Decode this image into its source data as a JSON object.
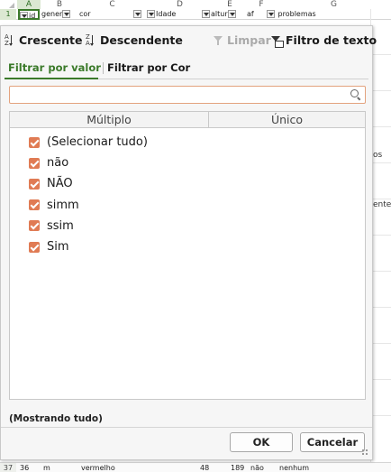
{
  "sheet": {
    "columns": [
      "A",
      "B",
      "C",
      "D",
      "E",
      "F",
      "G"
    ],
    "row1": {
      "rownum": "1",
      "A": "id",
      "B": "gener",
      "C": "cor",
      "D": "Idade",
      "E": "altur",
      "F": "af",
      "G": "problemas"
    },
    "side_texts": [
      "os",
      "ente"
    ],
    "row37": {
      "rownum": "37",
      "A": "36",
      "B": "m",
      "C": "vermelho",
      "D": "48",
      "E": "189",
      "F": "não",
      "G": "nenhum"
    }
  },
  "popup": {
    "sort": {
      "ascending_label": "Crescente",
      "descending_label": "Descendente",
      "clear_label": "Limpar",
      "text_filter_label": "Filtro de texto"
    },
    "tabs": [
      {
        "label": "Filtrar por valor",
        "active": true
      },
      {
        "label": "Filtrar por Cor",
        "active": false
      }
    ],
    "search": {
      "value": "",
      "placeholder": ""
    },
    "list": {
      "headers": [
        "Múltiplo",
        "Único"
      ],
      "items": [
        {
          "label": "(Selecionar tudo)",
          "checked": true
        },
        {
          "label": "não",
          "checked": true
        },
        {
          "label": "NÃO",
          "checked": true
        },
        {
          "label": "simm",
          "checked": true
        },
        {
          "label": "ssim",
          "checked": true
        },
        {
          "label": "Sim",
          "checked": true
        }
      ]
    },
    "status": "(Mostrando tudo)",
    "ok_label": "OK",
    "cancel_label": "Cancelar"
  },
  "colors": {
    "accent_green": "#3b7a2a",
    "checkbox_orange": "#e07b54"
  },
  "icons": [
    "sort-ascending-icon",
    "sort-descending-icon",
    "clear-filter-icon",
    "text-filter-icon",
    "search-icon",
    "checkbox-checked-icon",
    "resize-grip-icon"
  ]
}
